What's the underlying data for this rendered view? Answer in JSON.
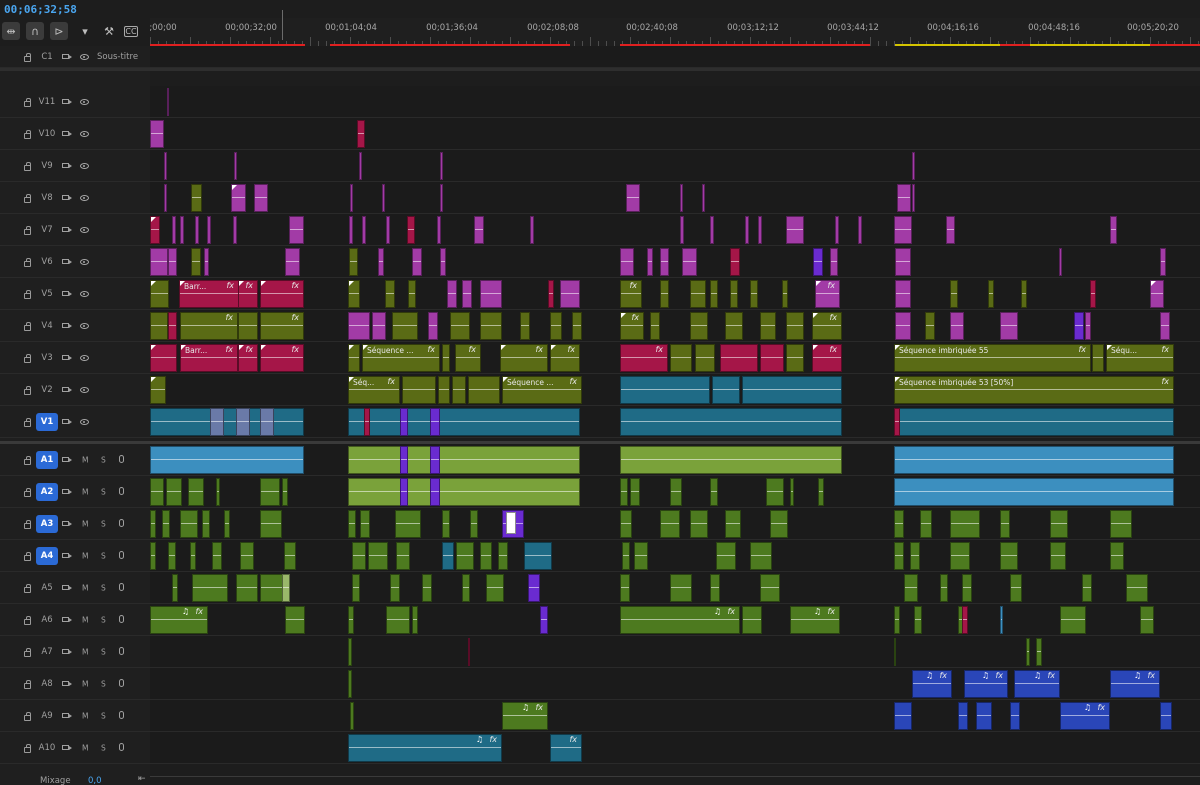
{
  "timecode": "00;06;32;58",
  "toolbar": {
    "icons": [
      "insert-tool-icon",
      "snap-magnet-icon",
      "linked-selection-icon",
      "add-marker-icon",
      "timeline-settings-wrench-icon",
      "captions-cc-icon"
    ],
    "captions_label": "CC"
  },
  "ruler": {
    "labels": [
      ";00;00",
      "00;00;32;00",
      "00;01;04;04",
      "00;01;36;04",
      "00;02;08;08",
      "00;02;40;08",
      "00;03;12;12",
      "00;03;44;12",
      "00;04;16;16",
      "00;04;48;16",
      "00;05;20;20"
    ]
  },
  "tracks": {
    "caption": {
      "name": "C1",
      "label": "Sous-titre"
    },
    "video": [
      "V11",
      "V10",
      "V9",
      "V8",
      "V7",
      "V6",
      "V5",
      "V4",
      "V3",
      "V2",
      "V1"
    ],
    "audio": [
      "A1",
      "A2",
      "A3",
      "A4",
      "A5",
      "A6",
      "A7",
      "A8",
      "A9",
      "A10"
    ],
    "mute_label": "M",
    "solo_label": "S"
  },
  "clip_labels": {
    "barr": "Barr...",
    "fx": "fx",
    "seq_short": "Séquence ...",
    "seq_short2": "Séq...",
    "seq55": "Séquence imbriquée 55",
    "seq_sq": "Séqu...",
    "seq53": "Séquence imbriquée 53 [50%]"
  },
  "mix": {
    "label": "Mixage",
    "value": "0,0"
  },
  "colors": {
    "magenta": "#a23ba6",
    "crimson": "#a51648",
    "olive": "#5a6b15",
    "teal": "#1f6b86",
    "sky": "#3c8fbf",
    "lime": "#7aa23a",
    "green": "#4d7a1f",
    "violet": "#6a2bd0",
    "blue": "#2a46b8",
    "timecode": "#4aa6f0",
    "active_track": "#2b6ad6"
  }
}
